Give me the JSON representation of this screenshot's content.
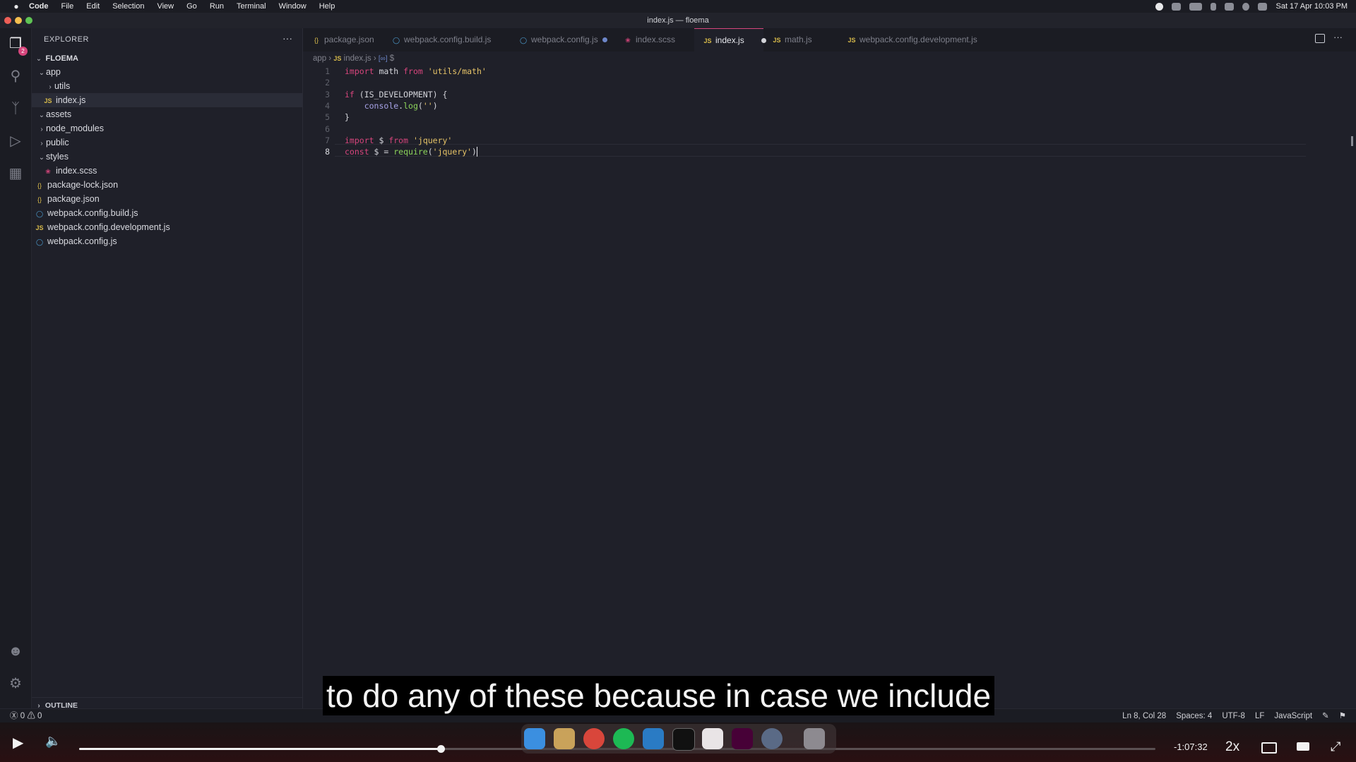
{
  "menubar": {
    "app_name": "Code",
    "items": [
      "File",
      "Edit",
      "Selection",
      "View",
      "Go",
      "Run",
      "Terminal",
      "Window",
      "Help"
    ],
    "datetime": "Sat 17 Apr  10:03 PM"
  },
  "window": {
    "title": "index.js — floema"
  },
  "activity": {
    "explorer_badge": "2"
  },
  "sidebar": {
    "header": "EXPLORER",
    "more": "···",
    "project": "FLOEMA",
    "tree": [
      {
        "label": "app",
        "kind": "folder-open",
        "indent": 1
      },
      {
        "label": "utils",
        "kind": "folder",
        "indent": 2
      },
      {
        "label": "index.js",
        "kind": "js",
        "indent": 2,
        "selected": true
      },
      {
        "label": "assets",
        "kind": "folder-open",
        "indent": 1
      },
      {
        "label": "node_modules",
        "kind": "folder",
        "indent": 1
      },
      {
        "label": "public",
        "kind": "folder",
        "indent": 1
      },
      {
        "label": "styles",
        "kind": "folder-open",
        "indent": 1
      },
      {
        "label": "index.scss",
        "kind": "scss",
        "indent": 2
      },
      {
        "label": "package-lock.json",
        "kind": "json",
        "indent": 1
      },
      {
        "label": "package.json",
        "kind": "json",
        "indent": 1
      },
      {
        "label": "webpack.config.build.js",
        "kind": "wp",
        "indent": 1
      },
      {
        "label": "webpack.config.development.js",
        "kind": "js",
        "indent": 1
      },
      {
        "label": "webpack.config.js",
        "kind": "wp",
        "indent": 1
      }
    ],
    "outline": "OUTLINE"
  },
  "tabs": [
    {
      "label": "package.json",
      "icon": "json"
    },
    {
      "label": "webpack.config.build.js",
      "icon": "wp"
    },
    {
      "label": "webpack.config.js",
      "icon": "wp",
      "modified": true
    },
    {
      "label": "index.scss",
      "icon": "scss"
    },
    {
      "label": "index.js",
      "icon": "js",
      "active": true,
      "modified": true
    },
    {
      "label": "math.js",
      "icon": "js"
    },
    {
      "label": "webpack.config.development.js",
      "icon": "js"
    }
  ],
  "breadcrumb": {
    "folder": "app",
    "file": "index.js",
    "symbol": "$"
  },
  "editor": {
    "current_line": 8,
    "lines": [
      {
        "n": "1",
        "tokens": [
          [
            "kw",
            "import"
          ],
          [
            "var",
            " math "
          ],
          [
            "kw",
            "from"
          ],
          [
            "var",
            " "
          ],
          [
            "str",
            "'utils/math'"
          ]
        ]
      },
      {
        "n": "2",
        "tokens": []
      },
      {
        "n": "3",
        "tokens": [
          [
            "kw",
            "if"
          ],
          [
            "var",
            " (IS_DEVELOPMENT) {"
          ]
        ]
      },
      {
        "n": "4",
        "tokens": [
          [
            "var",
            "    "
          ],
          [
            "obj",
            "console"
          ],
          [
            "var",
            "."
          ],
          [
            "fn",
            "log"
          ],
          [
            "var",
            "("
          ],
          [
            "str",
            "''"
          ],
          [
            "var",
            ")"
          ]
        ]
      },
      {
        "n": "5",
        "tokens": [
          [
            "var",
            "}"
          ]
        ]
      },
      {
        "n": "6",
        "tokens": []
      },
      {
        "n": "7",
        "tokens": [
          [
            "kw",
            "import"
          ],
          [
            "var",
            " $ "
          ],
          [
            "kw",
            "from"
          ],
          [
            "var",
            " "
          ],
          [
            "str",
            "'jquery'"
          ]
        ]
      },
      {
        "n": "8",
        "tokens": [
          [
            "kw",
            "const"
          ],
          [
            "var",
            " $ = "
          ],
          [
            "fn",
            "require"
          ],
          [
            "var",
            "("
          ],
          [
            "str",
            "'jquery'"
          ],
          [
            "var",
            ")"
          ]
        ]
      }
    ]
  },
  "statusbar": {
    "errors": "0",
    "warnings": "0",
    "position": "Ln 8, Col 28",
    "spaces": "Spaces: 4",
    "encoding": "UTF-8",
    "eol": "LF",
    "language": "JavaScript"
  },
  "caption": "to do any of these because in case we include",
  "player": {
    "time_remaining": "-1:07:32",
    "speed": "2x",
    "progress": 0.336
  }
}
